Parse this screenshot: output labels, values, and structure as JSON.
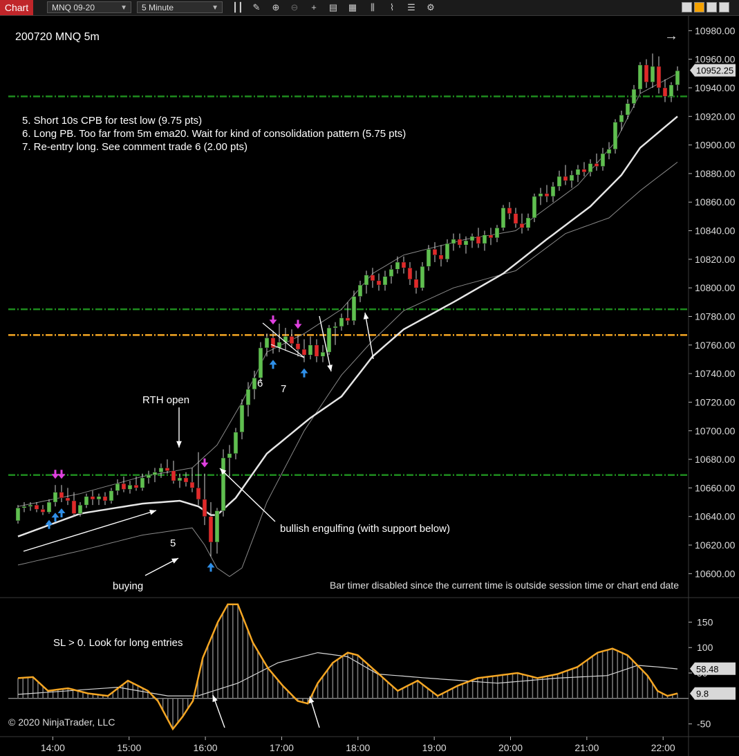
{
  "toolbar": {
    "tab_label": "Chart",
    "instrument": "MNQ 09-20",
    "interval": "5 Minute",
    "icons": [
      "bar-type-icon",
      "draw-pencil-icon",
      "zoom-in-icon",
      "zoom-out-icon",
      "crosshair-icon",
      "data-box-icon",
      "strategies-icon",
      "indicators-icon",
      "templates-icon",
      "properties-icon"
    ],
    "window_buttons": [
      "minimize",
      "maximize-accent",
      "restore",
      "close"
    ],
    "accent_color": "#f5a200",
    "tab_color": "#c0262a"
  },
  "chart_title": "200720 MNQ 5m",
  "notes": [
    "5. Short 10s CPB for test low (9.75 pts)",
    "6. Long PB. Too far from 5m ema20. Wait for kind of consolidation pattern (5.75 pts)",
    "7. Re-entry long. See comment trade 6 (2.00 pts)"
  ],
  "annotations": {
    "rth_open": "RTH open",
    "bullish_engulfing": "bullish engulfing (with support below)",
    "buying": "buying",
    "trade_5": "5",
    "trade_6": "6",
    "trade_7": "7",
    "bar_timer": "Bar timer disabled since the current time is outside session time or chart end date",
    "indicator_note": "SL > 0. Look for long entries",
    "copyright": "© 2020 NinjaTrader, LLC"
  },
  "colors": {
    "up": "#5fbf4f",
    "down": "#e02a2a",
    "support": "#1e8c1e",
    "key_level": "#f5a623",
    "ema": "#e6e6e6",
    "band": "#8a8a8a",
    "oscillator": "#f5a623",
    "signal": "#d8d8d8",
    "short_marker": "#e040e0",
    "long_marker": "#2f8fe8"
  },
  "chart_data": {
    "type": "candlestick",
    "price_axis": {
      "ylim": [
        10590,
        10985
      ],
      "ticks": [
        10600,
        10620,
        10640,
        10660,
        10680,
        10700,
        10720,
        10740,
        10760,
        10780,
        10800,
        10820,
        10840,
        10860,
        10880,
        10900,
        10920,
        10940,
        10960,
        10980
      ],
      "current_price": 10952.25,
      "current_label": "10952.25"
    },
    "time_axis": {
      "xlim": [
        "13:25",
        "22:20"
      ],
      "ticks": [
        "14:00",
        "15:00",
        "16:00",
        "17:00",
        "18:00",
        "19:00",
        "20:00",
        "21:00",
        "22:00"
      ]
    },
    "horizontal_lines": [
      {
        "price": 10934,
        "kind": "support"
      },
      {
        "price": 10785,
        "kind": "support"
      },
      {
        "price": 10767,
        "kind": "key_level"
      },
      {
        "price": 10669,
        "kind": "support"
      }
    ],
    "candles_ohlc": [
      [
        10637,
        10648,
        10635,
        10646
      ],
      [
        10646,
        10650,
        10643,
        10647
      ],
      [
        10647,
        10650,
        10644,
        10648
      ],
      [
        10648,
        10650,
        10643,
        10645
      ],
      [
        10645,
        10648,
        10641,
        10643
      ],
      [
        10643,
        10652,
        10642,
        10650
      ],
      [
        10650,
        10662,
        10647,
        10657
      ],
      [
        10657,
        10662,
        10650,
        10653
      ],
      [
        10653,
        10660,
        10648,
        10651
      ],
      [
        10651,
        10657,
        10640,
        10642
      ],
      [
        10642,
        10650,
        10640,
        10648
      ],
      [
        10648,
        10656,
        10646,
        10654
      ],
      [
        10654,
        10658,
        10648,
        10652
      ],
      [
        10652,
        10656,
        10648,
        10654
      ],
      [
        10654,
        10657,
        10648,
        10651
      ],
      [
        10651,
        10660,
        10649,
        10658
      ],
      [
        10658,
        10666,
        10655,
        10663
      ],
      [
        10663,
        10668,
        10657,
        10659
      ],
      [
        10659,
        10665,
        10656,
        10662
      ],
      [
        10662,
        10668,
        10658,
        10660
      ],
      [
        10660,
        10670,
        10658,
        10667
      ],
      [
        10667,
        10672,
        10663,
        10669
      ],
      [
        10669,
        10674,
        10664,
        10671
      ],
      [
        10671,
        10677,
        10667,
        10674
      ],
      [
        10674,
        10680,
        10670,
        10672
      ],
      [
        10672,
        10679,
        10663,
        10665
      ],
      [
        10665,
        10670,
        10660,
        10667
      ],
      [
        10667,
        10671,
        10661,
        10664
      ],
      [
        10664,
        10674,
        10657,
        10660
      ],
      [
        10660,
        10685,
        10648,
        10652
      ],
      [
        10652,
        10670,
        10634,
        10640
      ],
      [
        10640,
        10650,
        10612,
        10622
      ],
      [
        10622,
        10646,
        10614,
        10644
      ],
      [
        10644,
        10687,
        10640,
        10681
      ],
      [
        10681,
        10690,
        10668,
        10684
      ],
      [
        10684,
        10702,
        10680,
        10699
      ],
      [
        10699,
        10722,
        10694,
        10718
      ],
      [
        10718,
        10734,
        10710,
        10729
      ],
      [
        10729,
        10742,
        10722,
        10737
      ],
      [
        10737,
        10762,
        10734,
        10758
      ],
      [
        10758,
        10768,
        10752,
        10765
      ],
      [
        10765,
        10770,
        10754,
        10758
      ],
      [
        10758,
        10775,
        10755,
        10762
      ],
      [
        10762,
        10772,
        10756,
        10766
      ],
      [
        10766,
        10771,
        10758,
        10761
      ],
      [
        10761,
        10767,
        10752,
        10757
      ],
      [
        10757,
        10764,
        10748,
        10753
      ],
      [
        10753,
        10766,
        10750,
        10760
      ],
      [
        10760,
        10764,
        10748,
        10752
      ],
      [
        10752,
        10760,
        10748,
        10755
      ],
      [
        10755,
        10774,
        10753,
        10772
      ],
      [
        10772,
        10776,
        10760,
        10773
      ],
      [
        10773,
        10782,
        10770,
        10779
      ],
      [
        10779,
        10790,
        10774,
        10777
      ],
      [
        10777,
        10798,
        10774,
        10794
      ],
      [
        10794,
        10805,
        10790,
        10802
      ],
      [
        10802,
        10812,
        10796,
        10809
      ],
      [
        10809,
        10814,
        10800,
        10805
      ],
      [
        10805,
        10810,
        10798,
        10802
      ],
      [
        10802,
        10812,
        10798,
        10808
      ],
      [
        10808,
        10816,
        10803,
        10813
      ],
      [
        10813,
        10822,
        10810,
        10818
      ],
      [
        10818,
        10822,
        10810,
        10814
      ],
      [
        10814,
        10818,
        10802,
        10806
      ],
      [
        10806,
        10812,
        10796,
        10800
      ],
      [
        10800,
        10818,
        10798,
        10815
      ],
      [
        10815,
        10830,
        10812,
        10827
      ],
      [
        10827,
        10832,
        10818,
        10823
      ],
      [
        10823,
        10830,
        10815,
        10820
      ],
      [
        10820,
        10834,
        10818,
        10831
      ],
      [
        10831,
        10838,
        10826,
        10834
      ],
      [
        10834,
        10838,
        10828,
        10830
      ],
      [
        10830,
        10836,
        10824,
        10833
      ],
      [
        10833,
        10838,
        10828,
        10836
      ],
      [
        10836,
        10842,
        10828,
        10831
      ],
      [
        10831,
        10840,
        10826,
        10837
      ],
      [
        10837,
        10842,
        10830,
        10835
      ],
      [
        10835,
        10844,
        10832,
        10842
      ],
      [
        10842,
        10858,
        10840,
        10856
      ],
      [
        10856,
        10860,
        10848,
        10852
      ],
      [
        10852,
        10856,
        10842,
        10845
      ],
      [
        10845,
        10852,
        10838,
        10842
      ],
      [
        10842,
        10852,
        10840,
        10849
      ],
      [
        10849,
        10866,
        10846,
        10864
      ],
      [
        10864,
        10870,
        10858,
        10866
      ],
      [
        10866,
        10872,
        10860,
        10864
      ],
      [
        10864,
        10874,
        10860,
        10871
      ],
      [
        10871,
        10882,
        10868,
        10878
      ],
      [
        10878,
        10886,
        10872,
        10875
      ],
      [
        10875,
        10882,
        10870,
        10879
      ],
      [
        10879,
        10886,
        10874,
        10883
      ],
      [
        10883,
        10888,
        10878,
        10881
      ],
      [
        10881,
        10890,
        10878,
        10887
      ],
      [
        10887,
        10894,
        10882,
        10885
      ],
      [
        10885,
        10898,
        10882,
        10894
      ],
      [
        10894,
        10902,
        10890,
        10897
      ],
      [
        10897,
        10918,
        10894,
        10916
      ],
      [
        10916,
        10924,
        10910,
        10921
      ],
      [
        10921,
        10932,
        10918,
        10929
      ],
      [
        10929,
        10942,
        10926,
        10939
      ],
      [
        10939,
        10958,
        10936,
        10956
      ],
      [
        10956,
        10960,
        10940,
        10944
      ],
      [
        10944,
        10964,
        10940,
        10955
      ],
      [
        10955,
        10962,
        10936,
        10940
      ],
      [
        10940,
        10946,
        10930,
        10934
      ],
      [
        10934,
        10944,
        10930,
        10942
      ],
      [
        10942,
        10955,
        10938,
        10952
      ]
    ],
    "ema20_anchor": [
      [
        0,
        10626
      ],
      [
        10,
        10642
      ],
      [
        20,
        10649
      ],
      [
        26,
        10651
      ],
      [
        29,
        10647
      ],
      [
        31,
        10641
      ],
      [
        32,
        10641
      ],
      [
        35,
        10653
      ],
      [
        40,
        10684
      ],
      [
        47,
        10709
      ],
      [
        52,
        10724
      ],
      [
        57,
        10752
      ],
      [
        62,
        10771
      ],
      [
        70,
        10790
      ],
      [
        78,
        10810
      ],
      [
        85,
        10834
      ],
      [
        92,
        10857
      ],
      [
        97,
        10879
      ],
      [
        100,
        10898
      ],
      [
        106,
        10920
      ]
    ],
    "upper_band_anchor": [
      [
        0,
        10647
      ],
      [
        10,
        10656
      ],
      [
        20,
        10668
      ],
      [
        28,
        10674
      ],
      [
        32,
        10690
      ],
      [
        36,
        10720
      ],
      [
        40,
        10755
      ],
      [
        46,
        10768
      ],
      [
        52,
        10785
      ],
      [
        57,
        10810
      ],
      [
        62,
        10823
      ],
      [
        72,
        10834
      ],
      [
        80,
        10840
      ],
      [
        90,
        10872
      ],
      [
        96,
        10902
      ],
      [
        100,
        10936
      ],
      [
        106,
        10950
      ]
    ],
    "lower_band_anchor": [
      [
        0,
        10606
      ],
      [
        10,
        10616
      ],
      [
        20,
        10627
      ],
      [
        28,
        10632
      ],
      [
        30,
        10620
      ],
      [
        32,
        10604
      ],
      [
        34,
        10598
      ],
      [
        36,
        10604
      ],
      [
        40,
        10650
      ],
      [
        46,
        10700
      ],
      [
        52,
        10739
      ],
      [
        57,
        10763
      ],
      [
        62,
        10784
      ],
      [
        70,
        10800
      ],
      [
        80,
        10812
      ],
      [
        88,
        10838
      ],
      [
        95,
        10849
      ],
      [
        100,
        10868
      ],
      [
        106,
        10888
      ]
    ],
    "trade_markers": [
      {
        "bar": 6,
        "type": "short"
      },
      {
        "bar": 7,
        "type": "short"
      },
      {
        "bar": 5,
        "type": "long"
      },
      {
        "bar": 6,
        "type": "long"
      },
      {
        "bar": 7,
        "type": "long"
      },
      {
        "bar": 30,
        "type": "short"
      },
      {
        "bar": 31,
        "type": "long"
      },
      {
        "bar": 41,
        "type": "short"
      },
      {
        "bar": 41,
        "type": "long"
      },
      {
        "bar": 45,
        "type": "short"
      },
      {
        "bar": 46,
        "type": "long"
      }
    ],
    "indicator": {
      "ylim": [
        -75,
        190
      ],
      "ticks": [
        150,
        100,
        50,
        -50
      ],
      "zero_line": 0,
      "last_signal_label": "58.48",
      "last_osc_label": "9.8",
      "osc_anchor": [
        [
          0,
          40
        ],
        [
          3,
          42
        ],
        [
          6,
          15
        ],
        [
          10,
          20
        ],
        [
          14,
          10
        ],
        [
          18,
          5
        ],
        [
          22,
          35
        ],
        [
          26,
          15
        ],
        [
          28,
          -5
        ],
        [
          31,
          -60
        ],
        [
          33,
          -35
        ],
        [
          35,
          -5
        ],
        [
          37,
          80
        ],
        [
          40,
          150
        ],
        [
          42,
          185
        ],
        [
          44,
          185
        ],
        [
          47,
          110
        ],
        [
          50,
          60
        ],
        [
          53,
          25
        ],
        [
          56,
          -5
        ],
        [
          58,
          -10
        ],
        [
          60,
          30
        ],
        [
          63,
          70
        ],
        [
          66,
          90
        ],
        [
          68,
          85
        ],
        [
          72,
          50
        ],
        [
          76,
          15
        ],
        [
          80,
          35
        ],
        [
          84,
          5
        ],
        [
          88,
          25
        ],
        [
          92,
          40
        ],
        [
          96,
          45
        ],
        [
          100,
          50
        ],
        [
          104,
          40
        ],
        [
          108,
          48
        ],
        [
          112,
          62
        ],
        [
          116,
          90
        ],
        [
          119,
          98
        ],
        [
          122,
          85
        ],
        [
          126,
          45
        ],
        [
          128,
          15
        ],
        [
          130,
          5
        ],
        [
          132,
          10
        ]
      ],
      "signal_anchor": [
        [
          0,
          8
        ],
        [
          20,
          22
        ],
        [
          30,
          5
        ],
        [
          36,
          5
        ],
        [
          44,
          30
        ],
        [
          52,
          70
        ],
        [
          60,
          90
        ],
        [
          66,
          82
        ],
        [
          72,
          48
        ],
        [
          82,
          40
        ],
        [
          96,
          30
        ],
        [
          108,
          40
        ],
        [
          118,
          45
        ],
        [
          124,
          65
        ],
        [
          128,
          62
        ],
        [
          132,
          58
        ]
      ]
    }
  }
}
